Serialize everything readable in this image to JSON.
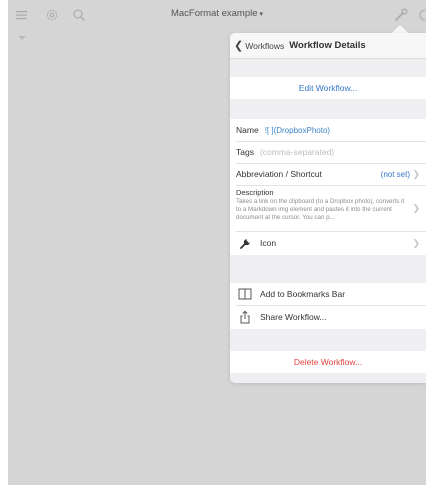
{
  "toolbar": {
    "title": "MacFormat example",
    "title_caret": "▾",
    "icons": [
      "menu-icon",
      "gear-icon",
      "search-icon",
      "wrench-icon"
    ]
  },
  "popover": {
    "back_label": "Workflows",
    "title": "Workflow Details",
    "edit_workflow": "Edit Workflow...",
    "name_label": "Name",
    "name_value": "![ ](DropboxPhoto)",
    "tags_label": "Tags",
    "tags_placeholder": "(comma-separated)",
    "abbreviation_label": "Abbreviation / Shortcut",
    "abbreviation_value": "(not set)",
    "description_label": "Description",
    "description_text": "Takes a link on the clipboard (to a Dropbox photo), converts it to a Markdown img element and pastes it into the current document at the cursor. You can p...",
    "icon_label": "Icon",
    "bookmarks_label": "Add to Bookmarks Bar",
    "share_label": "Share Workflow...",
    "delete_label": "Delete Workflow..."
  },
  "colors": {
    "accent": "#3478c9",
    "destructive": "#e3443f",
    "background": "#d5d5d5"
  }
}
